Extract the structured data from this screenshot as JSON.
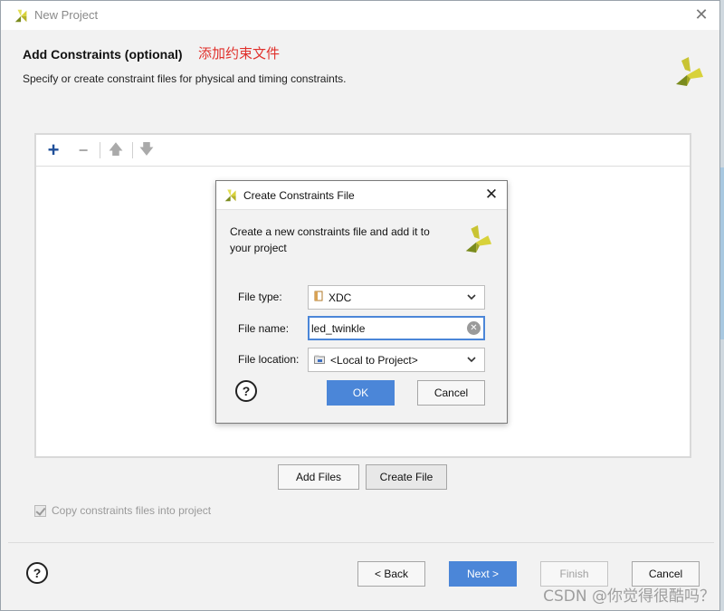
{
  "window": {
    "title": "New Project"
  },
  "header": {
    "title": "Add Constraints (optional)",
    "annotation": "添加约束文件",
    "subtitle": "Specify or create constraint files for physical and timing constraints."
  },
  "panel": {
    "buttons": {
      "add_files": "Add Files",
      "create_file": "Create File"
    }
  },
  "copy_option": {
    "label": "Copy constraints files into project",
    "checked": true
  },
  "nav": {
    "back": "< Back",
    "next": "Next >",
    "finish": "Finish",
    "cancel": "Cancel",
    "help": "?"
  },
  "dialog": {
    "title": "Create Constraints File",
    "description": "Create a new constraints file and add it to your project",
    "fields": {
      "file_type_label": "File type:",
      "file_type_value": "XDC",
      "file_name_label": "File name:",
      "file_name_value": "led_twinkle",
      "file_location_label": "File location:",
      "file_location_value": "<Local to Project>"
    },
    "help": "?",
    "ok": "OK",
    "cancel": "Cancel"
  },
  "watermark": "CSDN @你觉得很酷吗？",
  "colors": {
    "primary_button": "#4b86d8",
    "annotation": "#e0302b",
    "logo_yellow": "#d8d23a",
    "logo_green": "#7a8b1e"
  }
}
